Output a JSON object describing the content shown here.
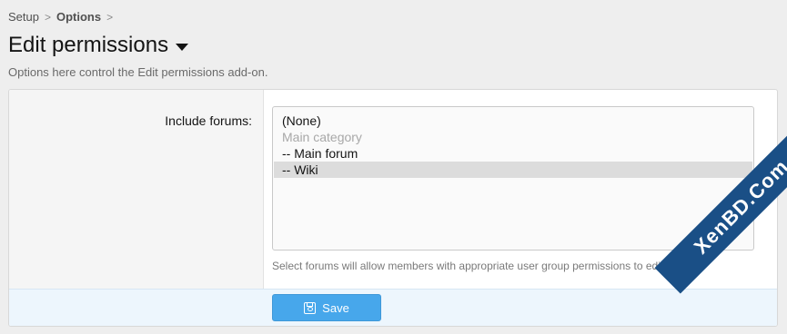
{
  "breadcrumb": {
    "items": [
      {
        "label": "Setup"
      },
      {
        "label": "Options"
      }
    ],
    "separator": ">"
  },
  "page": {
    "title": "Edit permissions",
    "description": "Options here control the Edit permissions add-on."
  },
  "form": {
    "include_forums": {
      "label": "Include forums:",
      "options": [
        {
          "label": "(None)",
          "disabled": false,
          "selected": false
        },
        {
          "label": "Main category",
          "disabled": true,
          "selected": false
        },
        {
          "label": "-- Main forum",
          "disabled": false,
          "selected": false
        },
        {
          "label": "-- Wiki",
          "disabled": false,
          "selected": true
        }
      ],
      "hint": "Select forums will allow members with appropriate user group permissions to edit any r"
    },
    "save_label": "Save"
  },
  "colors": {
    "accent": "#47a7eb",
    "footer_bg": "#edf6fd",
    "page_bg": "#eeeeee"
  },
  "watermark": {
    "text": "XenBD.Com"
  }
}
